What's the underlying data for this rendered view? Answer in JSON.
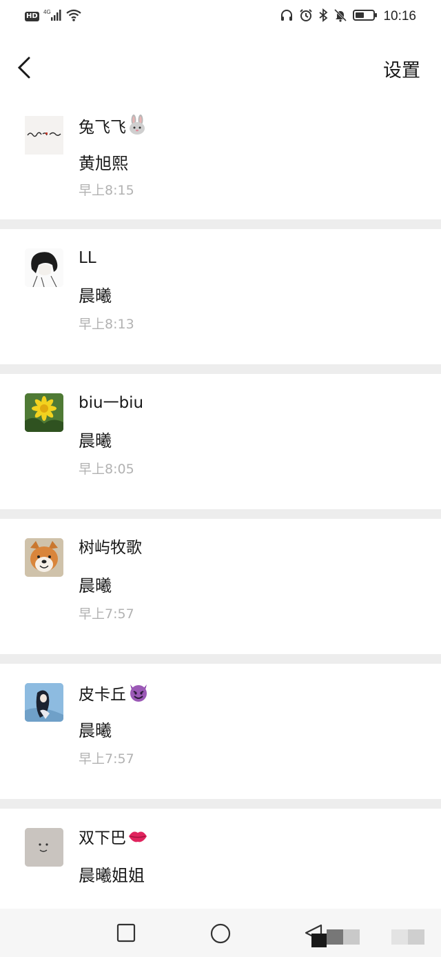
{
  "status_bar": {
    "hd": "HD",
    "network": "4G",
    "time": "10:16"
  },
  "header": {
    "back_icon": "chevron-left-icon",
    "settings_label": "设置"
  },
  "messages": [
    {
      "name": "兔飞飞",
      "emoji": "rabbit-emoji",
      "content": "黄旭熙",
      "time": "早上8:15"
    },
    {
      "name": "LL",
      "emoji": "",
      "content": "晨曦",
      "time": "早上8:13"
    },
    {
      "name": "biu一biu",
      "emoji": "",
      "content": "晨曦",
      "time": "早上8:05"
    },
    {
      "name": "树屿牧歌",
      "emoji": "",
      "content": "晨曦",
      "time": "早上7:57"
    },
    {
      "name": "皮卡丘",
      "emoji": "smiling-devil-emoji",
      "content": "晨曦",
      "time": "早上7:57"
    },
    {
      "name": "双下巴",
      "emoji": "kiss-lips-emoji",
      "content": "晨曦姐姐",
      "time": ""
    }
  ],
  "nav_bar": {
    "icons": [
      "recents-square-icon",
      "home-circle-icon",
      "back-triangle-icon"
    ]
  }
}
